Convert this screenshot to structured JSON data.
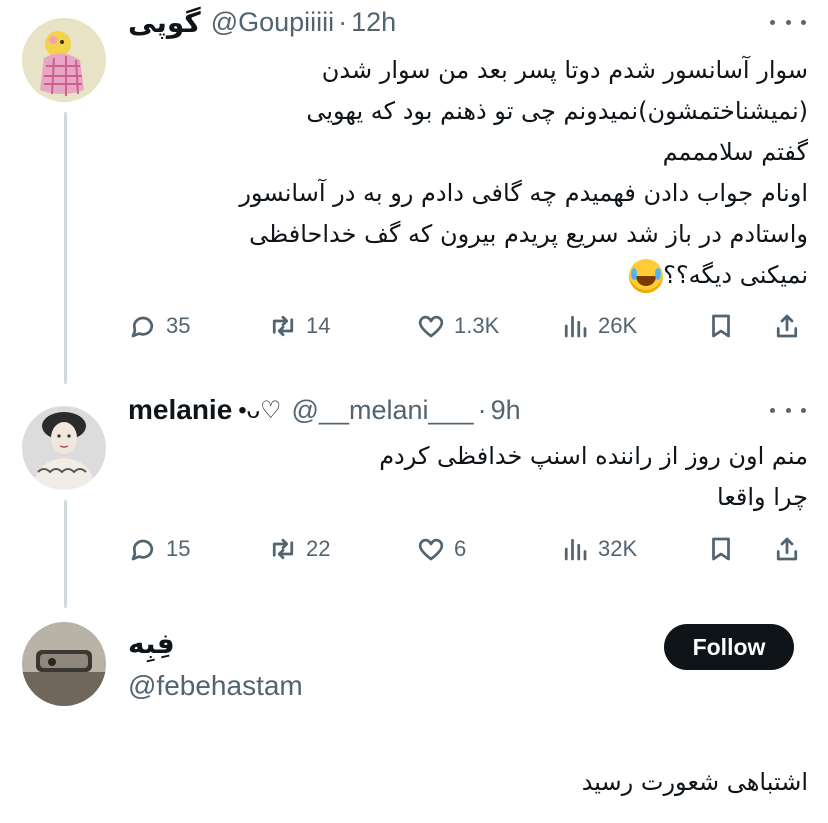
{
  "tweet1": {
    "name": "گوپی",
    "handle": "@Goupiiiii",
    "separator": "·",
    "time": "12h",
    "lines": [
      "سوار آسانسور شدم دوتا پسر بعد من سوار شدن",
      "(نمیشناختمشون)نمیدونم چی تو ذهنم بود که یهویی",
      "گفتم سلامممم",
      "اونام جواب دادن فهمیدم چه گافی دادم رو به در آسانسور",
      "واستادم در باز شد سریع پریدم بیرون  که گف خداحافظی",
      "نمیکنی دیگه؟؟"
    ],
    "emoji": "tears-of-joy-emoji",
    "replies": "35",
    "reposts": "14",
    "likes": "1.3K",
    "views": "26K"
  },
  "tweet2": {
    "name": "melanie",
    "name_decoration": "•ᴗ♡",
    "handle": "@__melani___",
    "separator": "·",
    "time": "9h",
    "lines": [
      "منم اون روز از راننده اسنپ خدافظی کردم",
      "چرا واقعا"
    ],
    "replies": "15",
    "reposts": "22",
    "likes": "6",
    "views": "32K"
  },
  "profile": {
    "name": "فِبِه",
    "handle": "@febehastam",
    "follow_label": "Follow",
    "bio": "اشتباهی شعورت رسید"
  },
  "colors": {
    "text": "#0f1419",
    "muted": "#536471",
    "thread_line": "#cfd9de",
    "follow_bg": "#0f1419"
  },
  "icons": [
    "reply-icon",
    "repost-icon",
    "like-icon",
    "views-icon",
    "bookmark-icon",
    "share-icon",
    "more-icon"
  ]
}
